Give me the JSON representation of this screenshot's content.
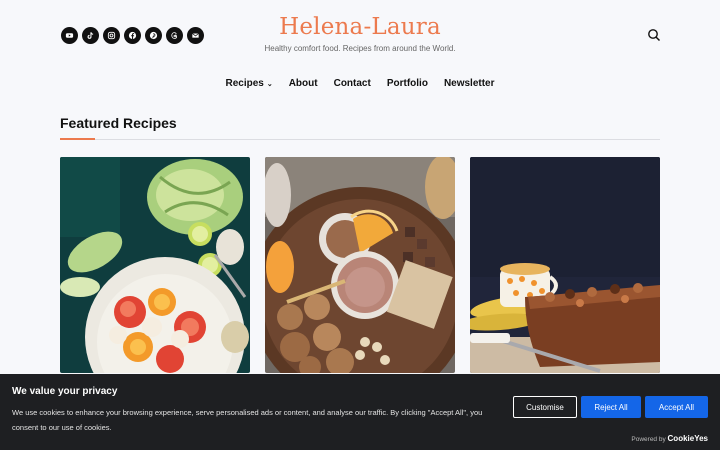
{
  "brand": {
    "title": "Helena-Laura",
    "tagline": "Healthy comfort food. Recipes from around the World.",
    "accent_color": "#ec7a4e"
  },
  "social_icons": [
    "youtube-icon",
    "tiktok-icon",
    "instagram-icon",
    "facebook-icon",
    "pinterest-icon",
    "threads-icon",
    "email-icon"
  ],
  "nav": {
    "items": [
      {
        "label": "Recipes",
        "chevron": "›"
      },
      {
        "label": "About"
      },
      {
        "label": "Contact"
      },
      {
        "label": "Portfolio"
      },
      {
        "label": "Newsletter"
      }
    ]
  },
  "featured": {
    "title": "Featured Recipes",
    "cards": [
      {
        "image": "salad-photo"
      },
      {
        "image": "smoothie-cookies-photo"
      },
      {
        "image": "banana-bread-photo"
      }
    ]
  },
  "cookie_banner": {
    "title": "We value your privacy",
    "text": "We use cookies to enhance your browsing experience, serve personalised ads or content, and analyse our traffic. By clicking \"Accept All\", you consent to our use of cookies.",
    "customise_label": "Customise",
    "reject_label": "Reject All",
    "accept_label": "Accept All",
    "powered_prefix": "Powered by",
    "powered_brand": "CookieYes",
    "button_color": "#1466e8"
  }
}
